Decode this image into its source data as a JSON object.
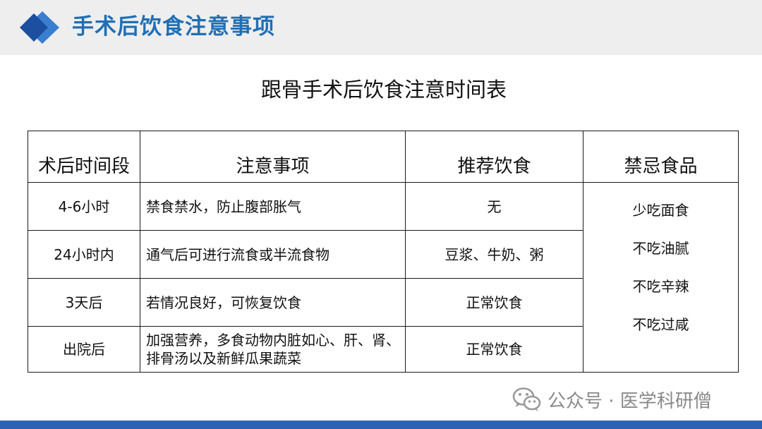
{
  "header": {
    "title": "手术后饮食注意事项"
  },
  "table": {
    "title": "跟骨手术后饮食注意时间表",
    "columns": [
      "术后时间段",
      "注意事项",
      "推荐饮食",
      "禁忌食品"
    ],
    "rows": [
      {
        "period": "4-6小时",
        "notes": "禁食禁水，防止腹部胀气",
        "recommended": "无"
      },
      {
        "period": "24小时内",
        "notes": "通气后可进行流食或半流食物",
        "recommended": "豆浆、牛奶、粥"
      },
      {
        "period": "3天后",
        "notes": "若情况良好，可恢复饮食",
        "recommended": "正常饮食"
      },
      {
        "period": "出院后",
        "notes": "加强营养，多食动物内脏如心、肝、肾、排骨汤以及新鲜瓜果蔬菜",
        "recommended": "正常饮食"
      }
    ],
    "taboo": [
      "少吃面食",
      "不吃油腻",
      "不吃辛辣",
      "不吃过咸"
    ]
  },
  "watermark": {
    "text": "公众号 · 医学科研僧"
  },
  "colors": {
    "accent": "#1f6fb5",
    "header_band": "#eeeeee",
    "bottom_bar": "#2c62b4"
  },
  "icons": {
    "logo": "double-diamond-icon",
    "watermark": "wechat-icon"
  }
}
